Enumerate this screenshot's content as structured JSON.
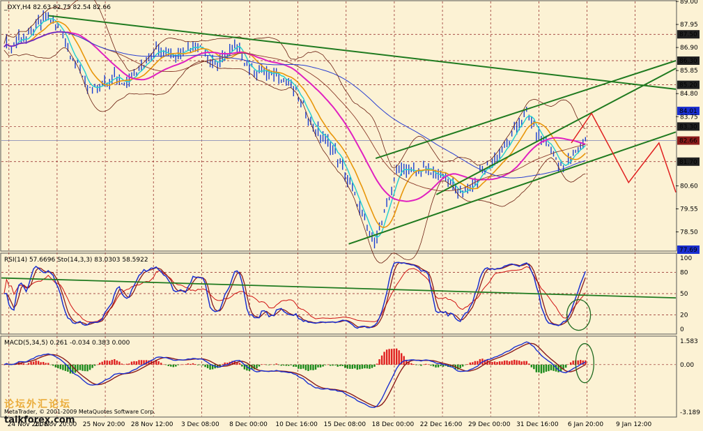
{
  "colors": {
    "background": "#FCF2D4",
    "grid": "#8B1A1A",
    "price_bar": "#1A3FD0",
    "ma_fast": "#28D0D0",
    "ma_orange": "#E8960A",
    "ma_magenta": "#E020C0",
    "ma_blue": "#2A3FD0",
    "ma_brown": "#8B3A2A",
    "bollinger": "#6B1E10",
    "trendline": "#1F7A1F",
    "forecast": "#E02020",
    "rsi": "#D01010",
    "stoch_main": "#1A2FD0",
    "stoch_signal": "#8B1A1A",
    "macd_pos": "#E02020",
    "macd_neg": "#1A8A1A",
    "ellipse": "#1F6A1F",
    "watermark": "#E8A020"
  },
  "header": {
    "main": "_DXY,H4  82.63 82.75 82.54 82.66",
    "rsi": "RSI(14) 57.6696  Sto(14,3,3) 83.0303 58.5922",
    "macd": "MACD(5,34,5) 0.261 -0.034 0.383 0.000"
  },
  "footer": {
    "copyright": "MetaTrader, © 2001-2009 MetaQuotes Software Corp.",
    "watermark": "论坛外汇论坛",
    "watermark_site": "talkforex.com"
  },
  "chart_data": [
    {
      "type": "candlestick",
      "symbol": "_DXY",
      "timeframe": "H4",
      "last": {
        "open": 82.63,
        "high": 82.75,
        "low": 82.54,
        "close": 82.66
      },
      "ylim": [
        77.69,
        89.0
      ],
      "y_ticks": [
        {
          "value": 89.0,
          "label": "89.00"
        },
        {
          "value": 87.95,
          "label": "87.95"
        },
        {
          "value": 87.5,
          "label": "87.50",
          "highlight": true
        },
        {
          "value": 86.9,
          "label": "86.90"
        },
        {
          "value": 86.3,
          "label": "86.30",
          "highlight": true
        },
        {
          "value": 85.85,
          "label": "85.85"
        },
        {
          "value": 85.2,
          "label": "85.20",
          "highlight": true
        },
        {
          "value": 84.8,
          "label": "84.80"
        },
        {
          "value": 84.01,
          "label": "84.01",
          "highlight": true,
          "color": "#1A2FD0"
        },
        {
          "value": 83.75,
          "label": "83.75"
        },
        {
          "value": 83.3,
          "label": "83.30",
          "highlight": true
        },
        {
          "value": 82.66,
          "label": "82.66",
          "highlight": true,
          "color": "#8B1A1A"
        },
        {
          "value": 81.7,
          "label": "81.70",
          "highlight": true
        },
        {
          "value": 80.6,
          "label": "80.60"
        },
        {
          "value": 79.55,
          "label": "79.55"
        },
        {
          "value": 78.5,
          "label": "78.50"
        },
        {
          "value": 77.69,
          "label": "77.69",
          "highlight": true,
          "color": "#1A2FD0"
        }
      ],
      "h_levels": [
        87.5,
        86.3,
        85.2,
        83.3,
        81.7
      ],
      "x_labels": [
        "24 Nov 2008",
        "21 Nov 20:00",
        "25 Nov 20:00",
        "28 Nov 12:00",
        "3 Dec 08:00",
        "8 Dec 00:00",
        "10 Dec 16:00",
        "15 Dec 08:00",
        "18 Dec 00:00",
        "22 Dec 16:00",
        "29 Dec 00:00",
        "31 Dec 16:00",
        "6 Jan 20:00",
        "9 Jan 12:00"
      ],
      "close_path": [
        87.1,
        86.9,
        87.4,
        87.2,
        87.8,
        88.0,
        88.3,
        87.9,
        87.6,
        86.7,
        86.1,
        85.4,
        84.9,
        85.1,
        85.3,
        85.6,
        85.4,
        85.5,
        85.7,
        86.2,
        86.6,
        86.9,
        86.7,
        86.5,
        86.8,
        86.9,
        87.0,
        86.9,
        86.4,
        86.2,
        86.5,
        86.9,
        86.8,
        86.1,
        85.8,
        85.9,
        85.6,
        85.8,
        85.5,
        85.2,
        84.6,
        84.0,
        83.3,
        82.9,
        82.6,
        82.1,
        81.5,
        80.6,
        79.8,
        78.9,
        78.1,
        78.6,
        79.6,
        80.9,
        81.5,
        81.3,
        81.2,
        81.4,
        81.2,
        81.1,
        80.9,
        80.6,
        80.2,
        80.5,
        80.8,
        81.3,
        81.5,
        81.9,
        82.3,
        82.8,
        83.5,
        83.9,
        83.3,
        82.7,
        82.5,
        81.8,
        81.4,
        81.9,
        82.3,
        82.66
      ],
      "trendlines": [
        {
          "from": [
            0.07,
            88.35
          ],
          "to": [
            1.0,
            85.0
          ],
          "label": "descending resistance"
        },
        {
          "from": [
            0.515,
            77.95
          ],
          "to": [
            1.0,
            83.05
          ],
          "label": "ascending support"
        },
        {
          "from": [
            0.555,
            81.85
          ],
          "to": [
            1.0,
            86.3
          ],
          "label": "channel upper"
        },
        {
          "from": [
            0.645,
            80.2
          ],
          "to": [
            1.0,
            85.95
          ],
          "label": "channel mid"
        }
      ],
      "forecast_path": [
        [
          0.845,
          82.55
        ],
        [
          0.875,
          83.9
        ],
        [
          0.93,
          80.75
        ],
        [
          0.975,
          82.55
        ],
        [
          1.0,
          80.3
        ]
      ]
    },
    {
      "type": "line",
      "name": "RSI / Stochastic",
      "ylim": [
        0,
        100
      ],
      "y_ticks": [
        {
          "value": 100,
          "label": "100"
        },
        {
          "value": 80,
          "label": "80"
        },
        {
          "value": 50,
          "label": "50"
        },
        {
          "value": 20,
          "label": "20"
        },
        {
          "value": 0,
          "label": "0"
        }
      ],
      "series": [
        {
          "name": "RSI(14)",
          "last": 57.6696
        },
        {
          "name": "Sto(14,3,3) main",
          "last": 83.0303
        },
        {
          "name": "Sto(14,3,3) signal",
          "last": 58.5922
        }
      ]
    },
    {
      "type": "bar",
      "name": "MACD(5,34,5)",
      "ylim": [
        -3.189,
        1.583
      ],
      "y_ticks": [
        {
          "value": 1.583,
          "label": "1.583"
        },
        {
          "value": 0.0,
          "label": "0.00"
        },
        {
          "value": -3.189,
          "label": "-3.189"
        }
      ],
      "last": {
        "macd": 0.261,
        "signal": -0.034,
        "histogram": 0.383,
        "zero": 0.0
      }
    }
  ]
}
